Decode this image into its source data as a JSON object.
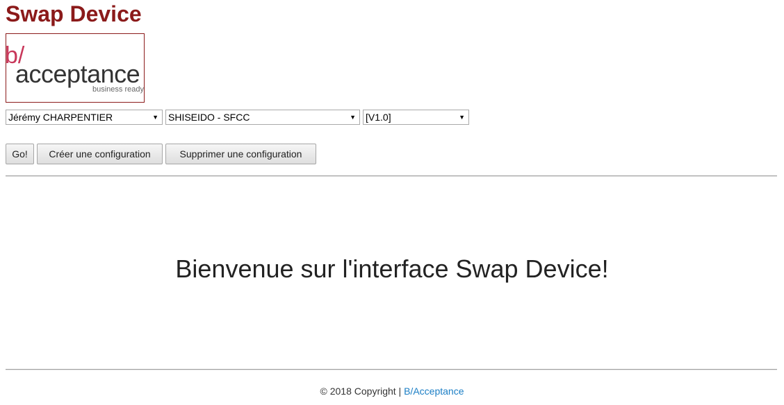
{
  "header": {
    "title": "Swap Device"
  },
  "logo": {
    "name": "acceptance",
    "tagline": "business ready",
    "mark": "b/",
    "brand_color": "#8b1a1a",
    "accent_color": "#c8375a"
  },
  "selects": {
    "user": "Jérémy CHARPENTIER",
    "client": "SHISEIDO - SFCC",
    "version": "[V1.0]"
  },
  "toolbar": {
    "go_label": "Go!",
    "create_label": "Créer une configuration",
    "delete_label": "Supprimer une configuration"
  },
  "main": {
    "welcome": "Bienvenue sur l'interface Swap Device!"
  },
  "footer": {
    "copyright": "© 2018 Copyright | ",
    "link_label": "B/Acceptance",
    "link_color": "#1a7ec5"
  }
}
